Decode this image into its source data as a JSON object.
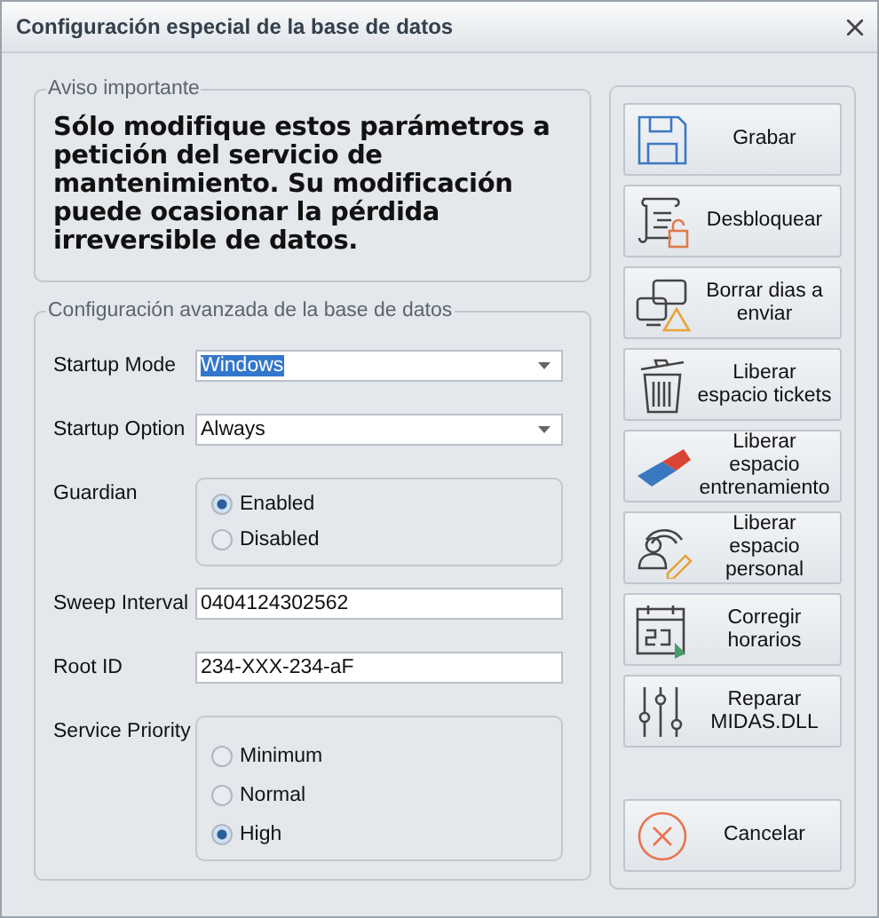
{
  "window": {
    "title": "Configuración especial de la base de datos"
  },
  "warning": {
    "legend": "Aviso importante",
    "text": "Sólo modifique estos parámetros a petición del servicio de mantenimiento. Su modificación puede ocasionar la pérdida irreversible de datos."
  },
  "config": {
    "legend": "Configuración avanzada de la base de datos",
    "fields": [
      {
        "kind": "select",
        "label": "Startup Mode",
        "value": "Windows",
        "focused": true
      },
      {
        "kind": "select",
        "label": "Startup Option",
        "value": "Always",
        "focused": false
      },
      {
        "kind": "radio",
        "label": "Guardian",
        "options": [
          {
            "label": "Enabled",
            "selected": true
          },
          {
            "label": "Disabled",
            "selected": false
          }
        ]
      },
      {
        "kind": "text",
        "label": "Sweep Interval",
        "value": "0404124302562"
      },
      {
        "kind": "text",
        "label": "Root ID",
        "value": "234-XXX-234-aF"
      },
      {
        "kind": "radio",
        "label": "Service Priority",
        "options": [
          {
            "label": "Minimum",
            "selected": false
          },
          {
            "label": "Normal",
            "selected": false
          },
          {
            "label": "High",
            "selected": true
          }
        ]
      }
    ]
  },
  "actions": [
    {
      "kind": "save",
      "label": "Grabar"
    },
    {
      "kind": "unlock",
      "label": "Desbloquear"
    },
    {
      "kind": "screens",
      "label": "Borrar dias a enviar"
    },
    {
      "kind": "trash",
      "label": "Liberar espacio tickets"
    },
    {
      "kind": "eraser",
      "label": "Liberar espacio entrenamiento"
    },
    {
      "kind": "people",
      "label": "Liberar espacio personal"
    },
    {
      "kind": "calendar",
      "label": "Corregir horarios"
    },
    {
      "kind": "sliders",
      "label": "Reparar MIDAS.DLL"
    }
  ],
  "cancel": {
    "kind": "cancel",
    "label": "Cancelar"
  }
}
